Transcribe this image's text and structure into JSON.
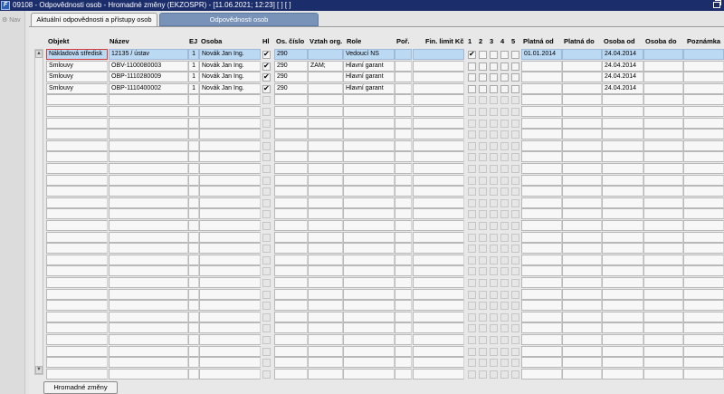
{
  "window": {
    "title": "09108 - Odpovědnosti osob - Hromadné změny (EKZOSPR) - [11.06.2021; 12:23]  [ ]  [ ]",
    "icon_name": "app-icon",
    "icon_glyph": "F"
  },
  "nav": {
    "label": "Nav",
    "icon_name": "nav-icon",
    "icon_glyph": "⚙"
  },
  "tabs": [
    {
      "label": "Aktuální odpovědnosti a přístupy osob",
      "active": true
    },
    {
      "label": "Odpovědnosti osob",
      "active": false
    }
  ],
  "columns": {
    "objekt": "Objekt",
    "nazev": "Název",
    "ej": "EJ",
    "osoba": "Osoba",
    "hl": "Hl",
    "os_cislo": "Os. číslo",
    "vztah": "Vztah org.",
    "role": "Role",
    "por": "Poř.",
    "fin_limit": "Fin. limit Kč",
    "c1": "1",
    "c2": "2",
    "c3": "3",
    "c4": "4",
    "c5": "5",
    "platna_od": "Platná od",
    "platna_do": "Platná do",
    "osoba_od": "Osoba od",
    "osoba_do": "Osoba do",
    "poznamka": "Poznámka"
  },
  "rows": [
    {
      "objekt": "Nákladová středisk",
      "nazev": "12135 / ústav",
      "ej": "1",
      "osoba": "Novák Jan Ing.",
      "hl": true,
      "os_cislo": "290",
      "vztah": "",
      "role": "Vedoucí NS",
      "por": "",
      "fin_limit": "",
      "c1": true,
      "c2": false,
      "c3": false,
      "c4": false,
      "c5": false,
      "platna_od": "01.01.2014",
      "platna_do": "",
      "osoba_od": "24.04.2014",
      "osoba_do": "",
      "poznamka": ""
    },
    {
      "objekt": "Smlouvy",
      "nazev": "OBV-1100080003",
      "ej": "1",
      "osoba": "Novák Jan Ing.",
      "hl": true,
      "os_cislo": "290",
      "vztah": "ZAM;",
      "role": "Hlavní garant",
      "por": "",
      "fin_limit": "",
      "c1": false,
      "c2": false,
      "c3": false,
      "c4": false,
      "c5": false,
      "platna_od": "",
      "platna_do": "",
      "osoba_od": "24.04.2014",
      "osoba_do": "",
      "poznamka": ""
    },
    {
      "objekt": "Smlouvy",
      "nazev": "OBP-1110280009",
      "ej": "1",
      "osoba": "Novák Jan Ing.",
      "hl": true,
      "os_cislo": "290",
      "vztah": "",
      "role": "Hlavní garant",
      "por": "",
      "fin_limit": "",
      "c1": false,
      "c2": false,
      "c3": false,
      "c4": false,
      "c5": false,
      "platna_od": "",
      "platna_do": "",
      "osoba_od": "24.04.2014",
      "osoba_do": "",
      "poznamka": ""
    },
    {
      "objekt": "Smlouvy",
      "nazev": "OBP-1110400002",
      "ej": "1",
      "osoba": "Novák Jan Ing.",
      "hl": true,
      "os_cislo": "290",
      "vztah": "",
      "role": "Hlavní garant",
      "por": "",
      "fin_limit": "",
      "c1": false,
      "c2": false,
      "c3": false,
      "c4": false,
      "c5": false,
      "platna_od": "",
      "platna_do": "",
      "osoba_od": "24.04.2014",
      "osoba_do": "",
      "poznamka": ""
    }
  ],
  "scrollbar": {
    "up_glyph": "▲",
    "down_glyph": "▼"
  },
  "buttons": {
    "hromadne_zmeny": "Hromadné změny"
  },
  "colors": {
    "titlebar": "#1b2d6b",
    "active_row": "#bcd9f4",
    "inactive_tab": "#7892b8"
  }
}
